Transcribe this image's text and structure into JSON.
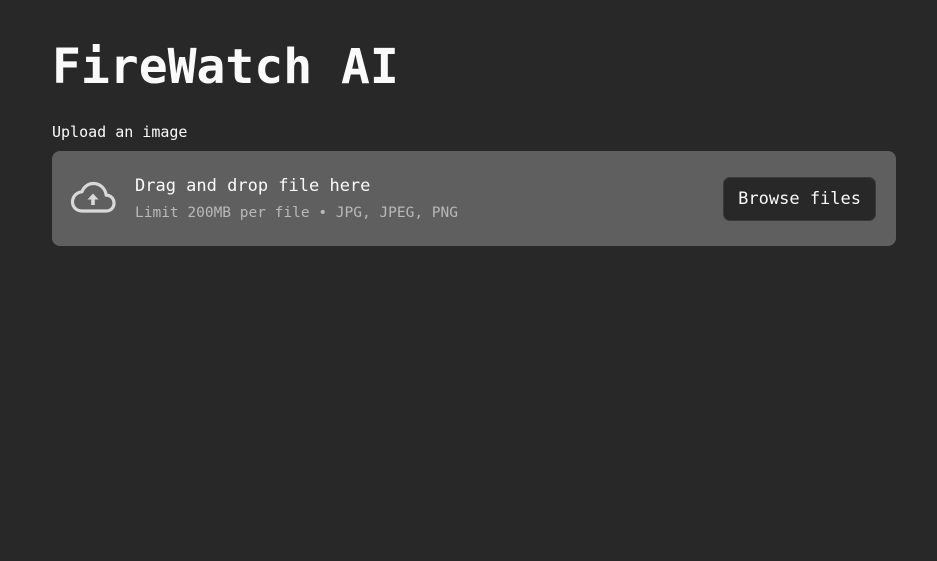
{
  "app": {
    "title": "FireWatch AI"
  },
  "uploader": {
    "label": "Upload an image",
    "dropzone_title": "Drag and drop file here",
    "dropzone_subtitle": "Limit 200MB per file • JPG, JPEG, PNG",
    "browse_label": "Browse files",
    "icon": "cloud-upload-icon"
  },
  "colors": {
    "background": "#282828",
    "dropzone": "#5f5f5f",
    "text": "#fafafa",
    "muted_text": "#b9b9b9",
    "button_bg": "#282828"
  }
}
